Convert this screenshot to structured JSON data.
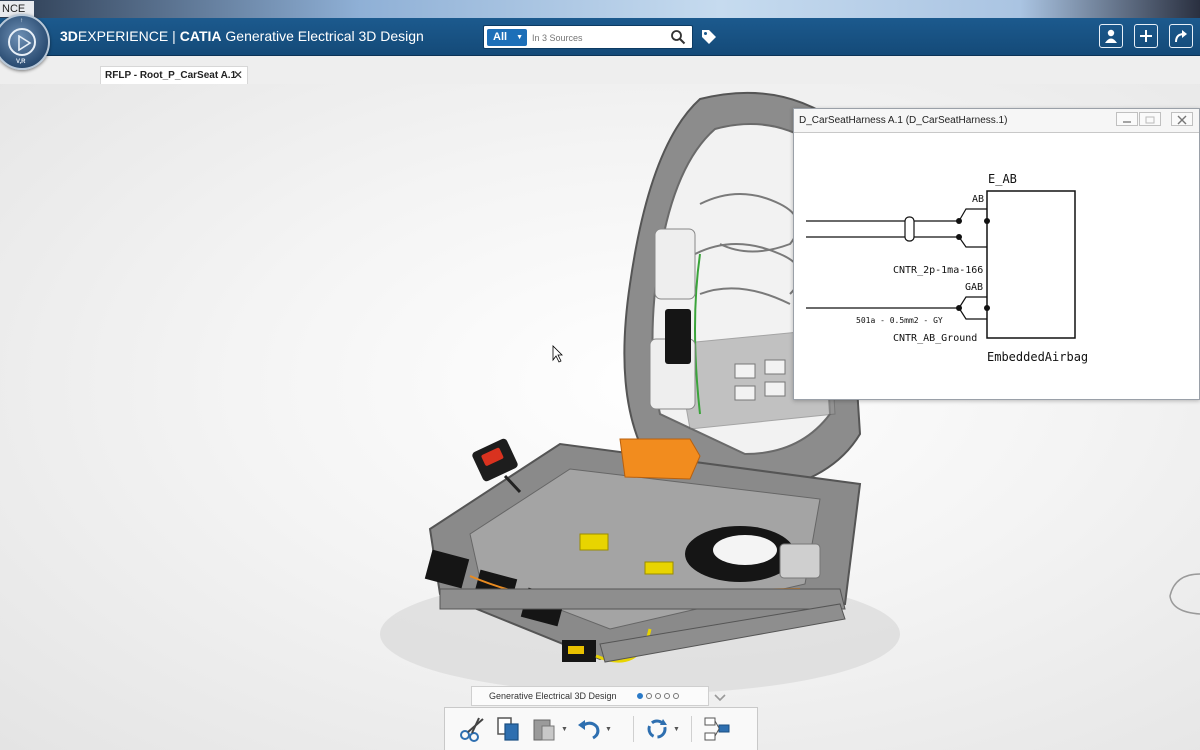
{
  "os": {
    "title_fragment": "NCE"
  },
  "header": {
    "compass_text": "V,R",
    "brand_3d": "3D",
    "brand_experience": "EXPERIENCE",
    "separator": "|",
    "brand_catia": "CATIA",
    "app_name": "Generative Electrical 3D Design"
  },
  "search": {
    "scope": "All",
    "placeholder": "In 3 Sources"
  },
  "tabs": [
    {
      "label": "RFLP - Root_P_CarSeat A.1",
      "close": "✕"
    }
  ],
  "schematic": {
    "window_title": "D_CarSeatHarness A.1 (D_CarSeatHarness.1)",
    "component_name": "E_AB",
    "pin1": "AB",
    "pin2": "GAB",
    "connector1": "CNTR_2p-1ma-166",
    "connector2": "CNTR_AB_Ground",
    "wire_label": "501a - 0.5mm2 - GY",
    "component_label": "EmbeddedAirbag"
  },
  "workbench": {
    "name": "Generative Electrical 3D Design",
    "page_count": 5,
    "active_page": 0
  },
  "action_bar": {
    "buttons": [
      {
        "name": "cut-icon"
      },
      {
        "name": "copy-icon"
      },
      {
        "name": "paste-icon"
      },
      {
        "name": "undo-icon"
      },
      {
        "name": "update-icon"
      },
      {
        "name": "structure-icon"
      }
    ]
  },
  "colors": {
    "header_blue": "#1c5a8e",
    "scope_blue": "#1d6fb8",
    "highlight_orange": "#f28c1e"
  }
}
